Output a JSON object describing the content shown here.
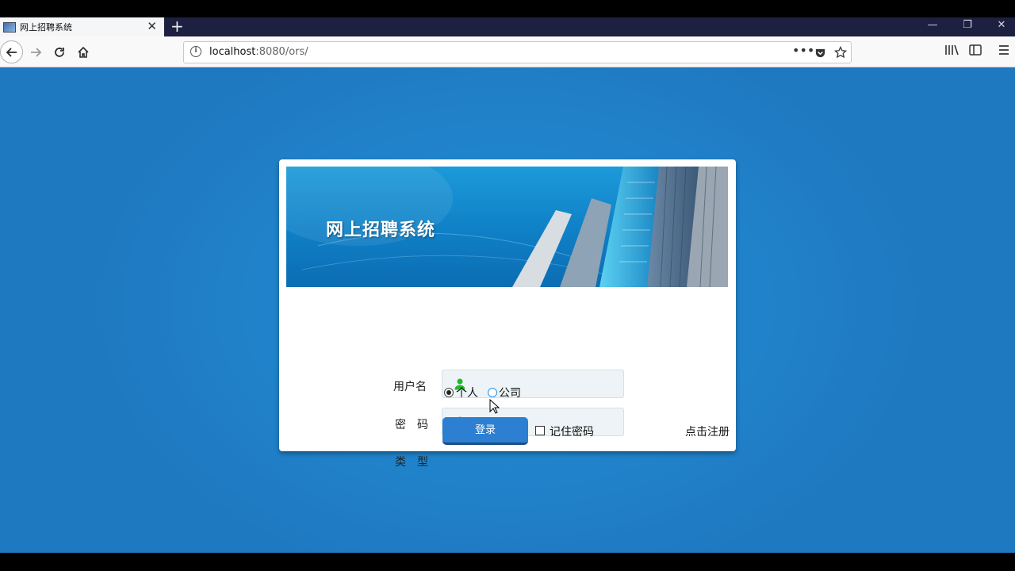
{
  "browser": {
    "tab_title": "网上招聘系统",
    "tab_close": "✕",
    "new_tab": "+",
    "url_host": "localhost",
    "url_rest": ":8080/ors/",
    "window_controls": {
      "minimize": "—",
      "restore": "❐",
      "close": "✕"
    }
  },
  "banner": {
    "title": "网上招聘系统"
  },
  "form": {
    "username_label": "用户名",
    "password_label": "密　码",
    "type_label": "类　型",
    "type_options": [
      "个人",
      "公司"
    ],
    "type_selected": "个人",
    "username_value": "",
    "password_value": "",
    "login_button": "登录",
    "remember_label": "记住密码",
    "remember_checked": false,
    "register_link": "点击注册"
  },
  "colors": {
    "page_bg": "#2086cd",
    "button": "#2c7fd1",
    "user_icon": "#1dbb2a"
  }
}
